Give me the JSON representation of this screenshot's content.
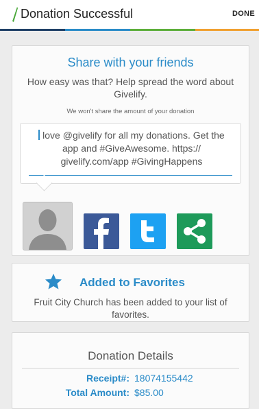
{
  "header": {
    "title": "Donation Successful",
    "done_label": "DONE",
    "stripe_colors": [
      "#1e3f66",
      "#2a8bc8",
      "#5cae3a",
      "#f0a030"
    ]
  },
  "share": {
    "title": "Share with your friends",
    "subtitle": "How easy was that? Help spread the word about Givelify.",
    "note": "We won't share the amount of your donation",
    "message": "love @givelify for all my donations. Get the app and #GiveAwesome. https:// givelify.com/app #GivingHappens",
    "buttons": [
      {
        "name": "facebook",
        "icon": "facebook-icon",
        "color": "#3b5998"
      },
      {
        "name": "twitter",
        "icon": "twitter-icon",
        "color": "#1da1f2"
      },
      {
        "name": "share",
        "icon": "share-icon",
        "color": "#1e9a5a"
      }
    ]
  },
  "favorites": {
    "title": "Added to Favorites",
    "text": "Fruit City Church has been added to your list of favorites."
  },
  "details": {
    "title": "Donation Details",
    "receipt_label": "Receipt#:",
    "receipt_value": "18074155442",
    "total_label": "Total Amount:",
    "total_value": "$85.00"
  },
  "colors": {
    "accent": "#2a8bc8",
    "background": "#ececec"
  }
}
